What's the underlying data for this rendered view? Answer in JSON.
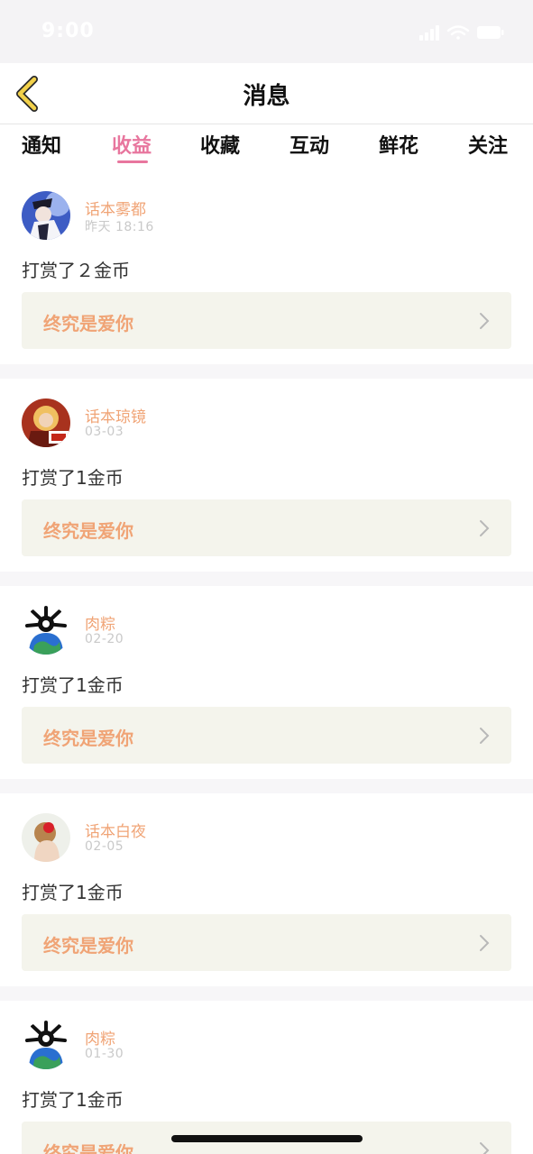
{
  "status": {
    "time": "9:00"
  },
  "nav": {
    "title": "消息"
  },
  "tabs": [
    {
      "label": "通知"
    },
    {
      "label": "收益"
    },
    {
      "label": "收藏"
    },
    {
      "label": "互动"
    },
    {
      "label": "鲜花"
    },
    {
      "label": "关注"
    }
  ],
  "active_tab": "收益",
  "colors": {
    "accent": "#e8769e",
    "name": "#f0a476",
    "link_bg": "#f4f4ec",
    "back_icon": "#f2d14a"
  },
  "messages": [
    {
      "user": "话本雾都",
      "time": "昨天 18:16",
      "text": "打赏了２金币",
      "target": "终究是爱你"
    },
    {
      "user": "话本琼镜",
      "time": "03-03",
      "text": "打赏了1金币",
      "target": "终究是爱你"
    },
    {
      "user": "肉粽",
      "time": "02-20",
      "text": "打赏了1金币",
      "target": "终究是爱你"
    },
    {
      "user": "话本白夜",
      "time": "02-05",
      "text": "打赏了1金币",
      "target": "终究是爱你"
    },
    {
      "user": "肉粽",
      "time": "01-30",
      "text": "打赏了1金币",
      "target": "终究是爱你"
    }
  ]
}
